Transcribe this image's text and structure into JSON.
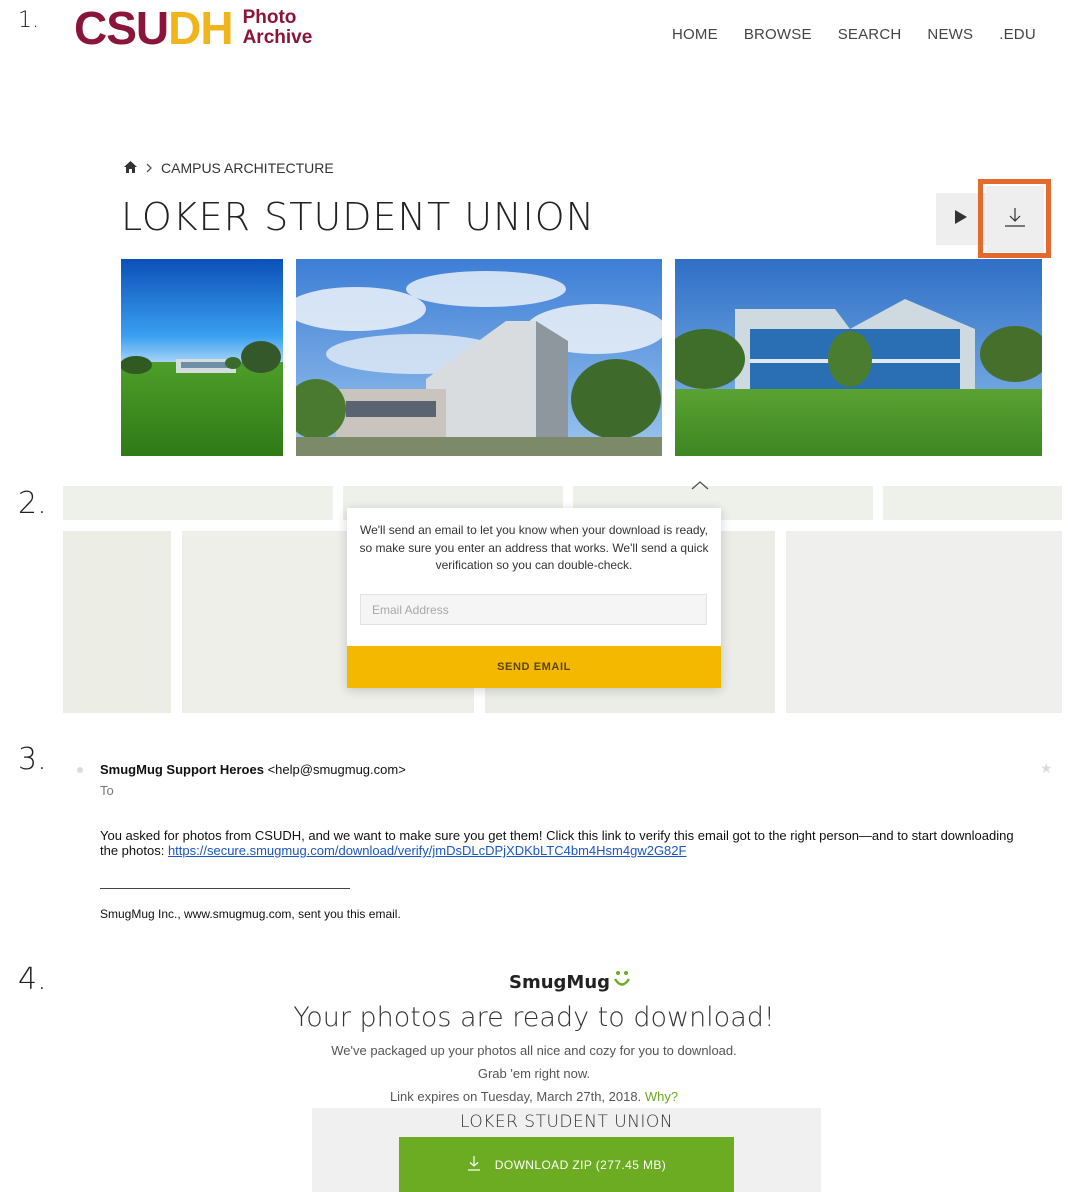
{
  "steps": [
    "1.",
    "2.",
    "3.",
    "4."
  ],
  "site": {
    "logo_cs": "CSU",
    "logo_dh": "DH",
    "logo_sub1": "Photo",
    "logo_sub2": "Archive",
    "nav": [
      "HOME",
      "BROWSE",
      "SEARCH",
      "NEWS",
      ".EDU"
    ]
  },
  "gallery": {
    "breadcrumb": "CAMPUS ARCHITECTURE",
    "title": "LOKER STUDENT UNION",
    "highlight_color": "#e36a2c",
    "icons": [
      "home-icon",
      "chevron-right-icon",
      "play-icon",
      "download-icon"
    ]
  },
  "modal": {
    "message": "We'll send an email to let you know when your download is ready, so make sure you enter an address that works. We'll send a quick verification so you can double-check.",
    "email_placeholder": "Email Address",
    "send_label": "SEND EMAIL",
    "send_color": "#f4b800"
  },
  "email": {
    "sender_name": "SmugMug Support Heroes",
    "sender_email": "<help@smugmug.com>",
    "to_label": "To",
    "body": "You asked for photos from CSUDH, and we want to make sure you get them! Click this link to verify this email got to the right person—and to start downloading the photos: ",
    "link": "https://secure.smugmug.com/download/verify/jmDsDLcDPjXDKbLTC4bm4Hsm4gw2G82F",
    "footer": "SmugMug Inc., www.smugmug.com, sent you this email."
  },
  "download": {
    "brand": "SmugMug",
    "heading": "Your photos are ready to download!",
    "line1": "We've packaged up your photos all nice and cozy for you to download.",
    "line2": "Grab 'em right now.",
    "expires": "Link expires on Tuesday, March 27th, 2018.",
    "why": "Why?",
    "gallery_title": "LOKER STUDENT UNION",
    "button_label": "DOWNLOAD ZIP (277.45 MB)",
    "button_color": "#6bac22"
  }
}
